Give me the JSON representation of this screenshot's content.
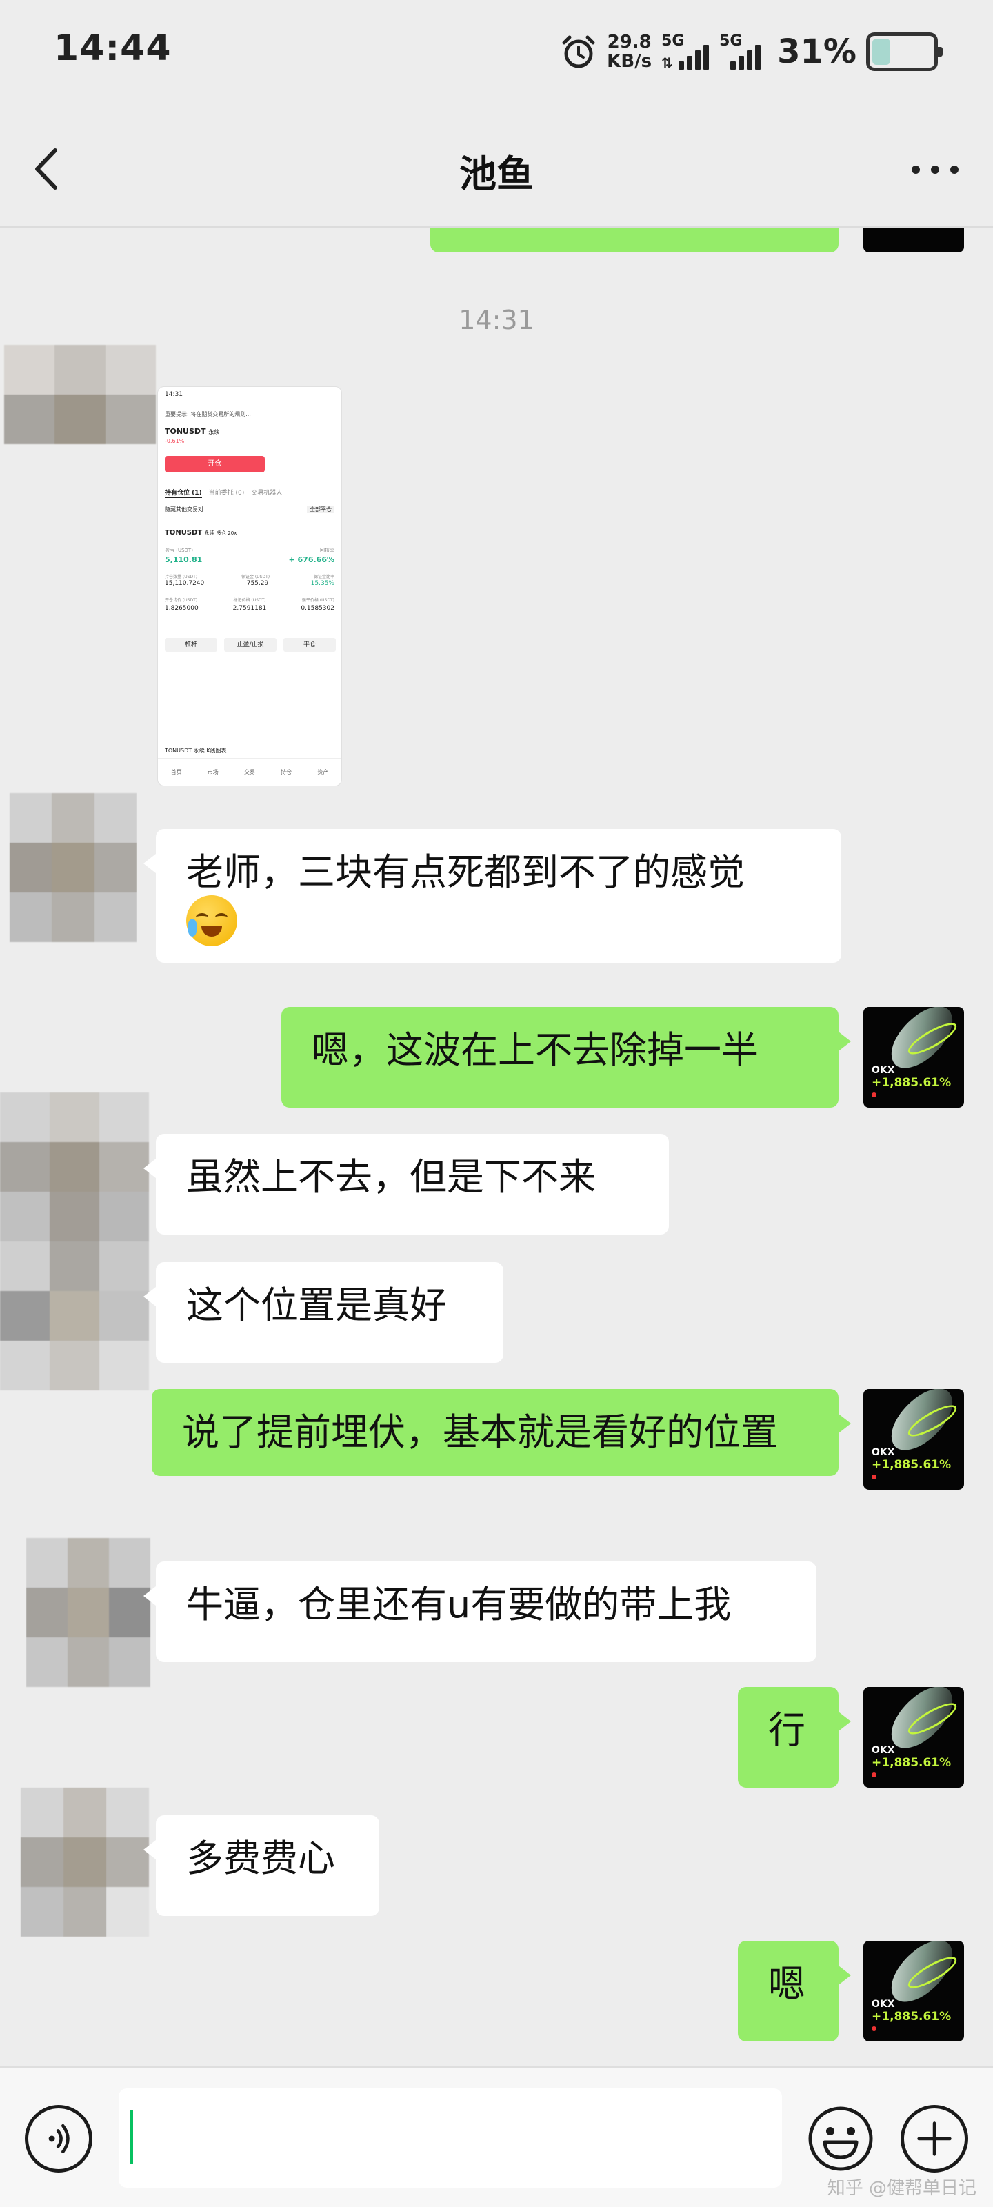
{
  "status_bar": {
    "time": "14:44",
    "speed_value": "29.8",
    "speed_unit": "KB/s",
    "net1": "5G",
    "net2": "5G",
    "battery": "31%"
  },
  "header": {
    "title": "池鱼"
  },
  "chat": {
    "timestamp": "14:31",
    "screenshot": {
      "time": "14:31",
      "notice": "重要提示: 将在期货交易所的规则...",
      "pair": "TONUSDT",
      "pair_sub": "永续",
      "price_change": "-0.61%",
      "open_label": "开仓",
      "tab_positions": "持有仓位 (1)",
      "tab_orders": "当前委托 (0)",
      "tab_bots": "交易机器人",
      "hide_other": "隐藏其他交易对",
      "close_all": "全部平仓",
      "position_pair": "TONUSDT",
      "position_side": "永续",
      "position_leverage": "多仓 20x",
      "unrealized_label": "盈亏 (USDT)",
      "unrealized_value": "5,110.81",
      "roi_label": "回报率",
      "roi_value": "+ 676.66%",
      "size_label": "持仓数量 (USDT)",
      "size_value": "15,110.7240",
      "margin_label": "保证金 (USDT)",
      "margin_value": "755.29",
      "margin_ratio_label": "保证金比率",
      "margin_ratio_value": "15.35%",
      "entry_label": "开仓均价 (USDT)",
      "entry_value": "1.8265000",
      "mark_label": "标记价格 (USDT)",
      "mark_value": "2.7591181",
      "liq_label": "强平价格 (USDT)",
      "liq_value": "0.1585302",
      "btn_leverage": "杠杆",
      "btn_tpsl": "止盈/止损",
      "btn_close": "平仓",
      "bottom_text": "TONUSDT 永续 K线图表",
      "nav_items": [
        "首页",
        "市场",
        "交易",
        "持仓",
        "资产"
      ]
    },
    "messages": [
      {
        "side": "left",
        "text": "老师，三块有点死都到不了的感觉"
      },
      {
        "side": "right",
        "text": "嗯，这波在上不去除掉一半"
      },
      {
        "side": "left",
        "text": "虽然上不去，但是下不来"
      },
      {
        "side": "left",
        "text": "这个位置是真好"
      },
      {
        "side": "right",
        "text": "说了提前埋伏，基本就是看好的位置"
      },
      {
        "side": "left",
        "text": "牛逼，仓里还有u有要做的带上我"
      },
      {
        "side": "right",
        "text": "行"
      },
      {
        "side": "left",
        "text": "多费费心"
      },
      {
        "side": "right",
        "text": "嗯"
      }
    ],
    "my_avatar": {
      "brand": "OKX",
      "percent": "+1,885.61%"
    }
  },
  "input_bar": {
    "placeholder": ""
  },
  "watermark": "知乎 @健帮单日记",
  "colors": {
    "bubble_mine": "#95ec69",
    "bubble_theirs": "#ffffff",
    "background": "#ededed",
    "caret": "#07c160"
  },
  "icons": [
    "alarm-icon",
    "back-icon",
    "more-icon",
    "voice-icon",
    "emoji-icon",
    "plus-icon",
    "laughing-tears-emoji"
  ]
}
